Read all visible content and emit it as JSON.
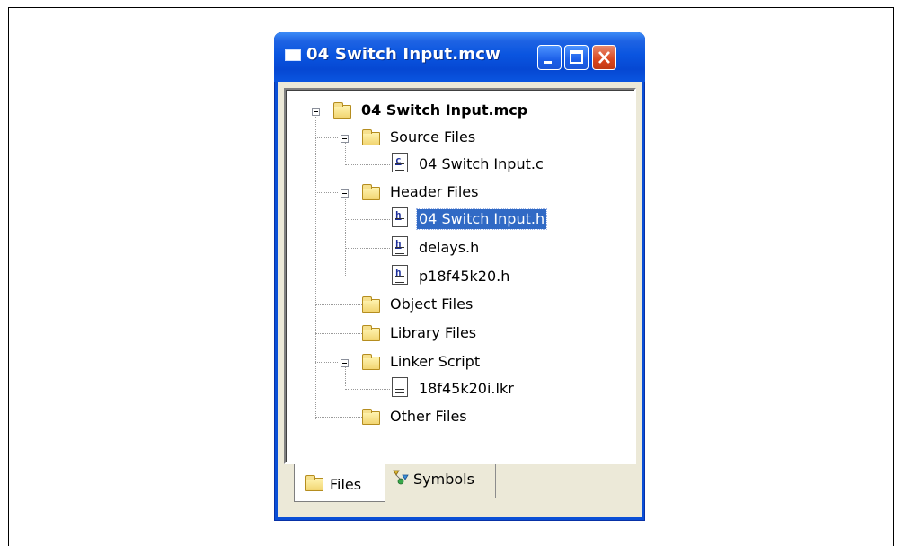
{
  "window": {
    "title": "04 Switch Input.mcw"
  },
  "tree": {
    "root": "04 Switch Input.mcp",
    "source_files": "Source Files",
    "source_file_1": "04 Switch Input.c",
    "header_files": "Header Files",
    "header_file_1": "04 Switch Input.h",
    "header_file_2": "delays.h",
    "header_file_3": "p18f45k20.h",
    "object_files": "Object Files",
    "library_files": "Library Files",
    "linker_script": "Linker Script",
    "linker_file_1": "18f45k20i.lkr",
    "other_files": "Other Files",
    "selected": "04 Switch Input.h"
  },
  "tabs": {
    "files": "Files",
    "symbols": "Symbols",
    "active": "Files"
  },
  "icons": {
    "c_letter": "c",
    "h_letter": "h"
  }
}
